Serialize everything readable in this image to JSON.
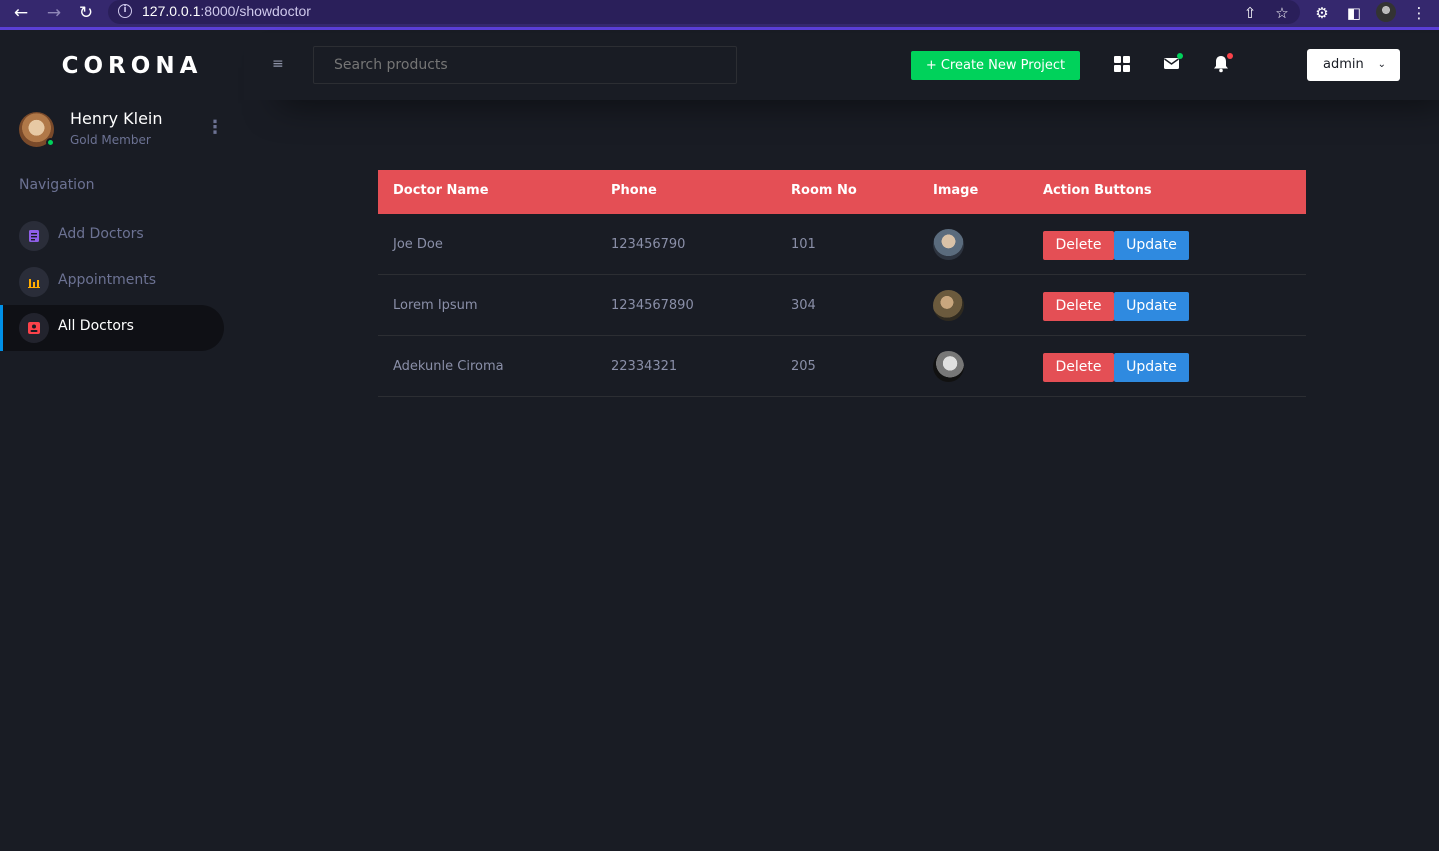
{
  "browser": {
    "url_host": "127.0.0.1",
    "url_rest": ":8000/showdoctor"
  },
  "sidebar": {
    "brand": "CORONA",
    "profile": {
      "name": "Henry Klein",
      "role": "Gold Member"
    },
    "nav_title": "Navigation",
    "items": [
      {
        "label": "Add Doctors",
        "icon": "document-icon",
        "color": "#8f5fe8"
      },
      {
        "label": "Appointments",
        "icon": "bar-chart-icon",
        "color": "#ffab00"
      },
      {
        "label": "All Doctors",
        "icon": "contact-icon",
        "color": "#fc424a",
        "active": true
      }
    ]
  },
  "navbar": {
    "search_placeholder": "Search products",
    "create_label": "+ Create New Project",
    "admin_label": "admin"
  },
  "table": {
    "headers": [
      "Doctor Name",
      "Phone",
      "Room No",
      "Image",
      "Action Buttons"
    ],
    "rows": [
      {
        "name": "Joe Doe",
        "phone": "123456790",
        "room": "101",
        "delete": "Delete",
        "update": "Update"
      },
      {
        "name": "Lorem Ipsum",
        "phone": "1234567890",
        "room": "304",
        "delete": "Delete",
        "update": "Update"
      },
      {
        "name": "Adekunle Ciroma",
        "phone": "22334321",
        "room": "205",
        "delete": "Delete",
        "update": "Update"
      }
    ]
  },
  "colors": {
    "background": "#191c24",
    "header_red": "#e44f55",
    "create_green": "#00d25b",
    "update_blue": "#2f8ae0",
    "active_bar": "#0090e7"
  }
}
